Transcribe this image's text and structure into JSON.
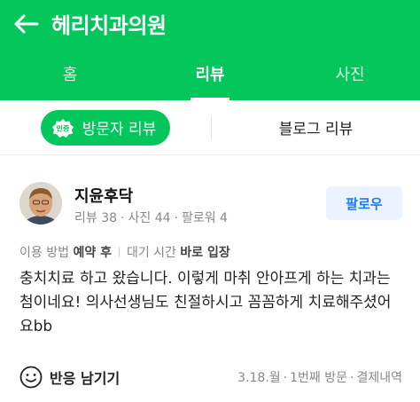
{
  "appbar": {
    "title": "헤리치과의원"
  },
  "tabs": [
    {
      "label": "홈",
      "active": false
    },
    {
      "label": "리뷰",
      "active": true
    },
    {
      "label": "사진",
      "active": false
    }
  ],
  "subtabs": {
    "badge": "인증",
    "visitor_reviews": "방문자 리뷰",
    "blog_reviews": "블로그 리뷰"
  },
  "review": {
    "user": {
      "name": "지윤후닥",
      "reviews": "리뷰 38",
      "photos": "사진 44",
      "followers": "팔로워 4"
    },
    "follow_label": "팔로우",
    "visit": {
      "method_label": "이용 방법",
      "method_value": "예약 후",
      "wait_label": "대기 시간",
      "wait_value": "바로 입장"
    },
    "text": "충치치료 하고 왔습니다. 이렇게 마취 안아프게 하는 치과는 첨이네요! 의사선생님도 친절하시고 꼼꼼하게 치료해주셨어요bb",
    "reaction_label": "반응 남기기",
    "meta": {
      "date": "3.18.월",
      "visit_count": "1번째 방문",
      "receipt": "결제내역"
    }
  },
  "colors": {
    "brand_green": "#03c75a",
    "follow_blue": "#1f7bf2",
    "follow_bg": "#eaf3fe"
  }
}
